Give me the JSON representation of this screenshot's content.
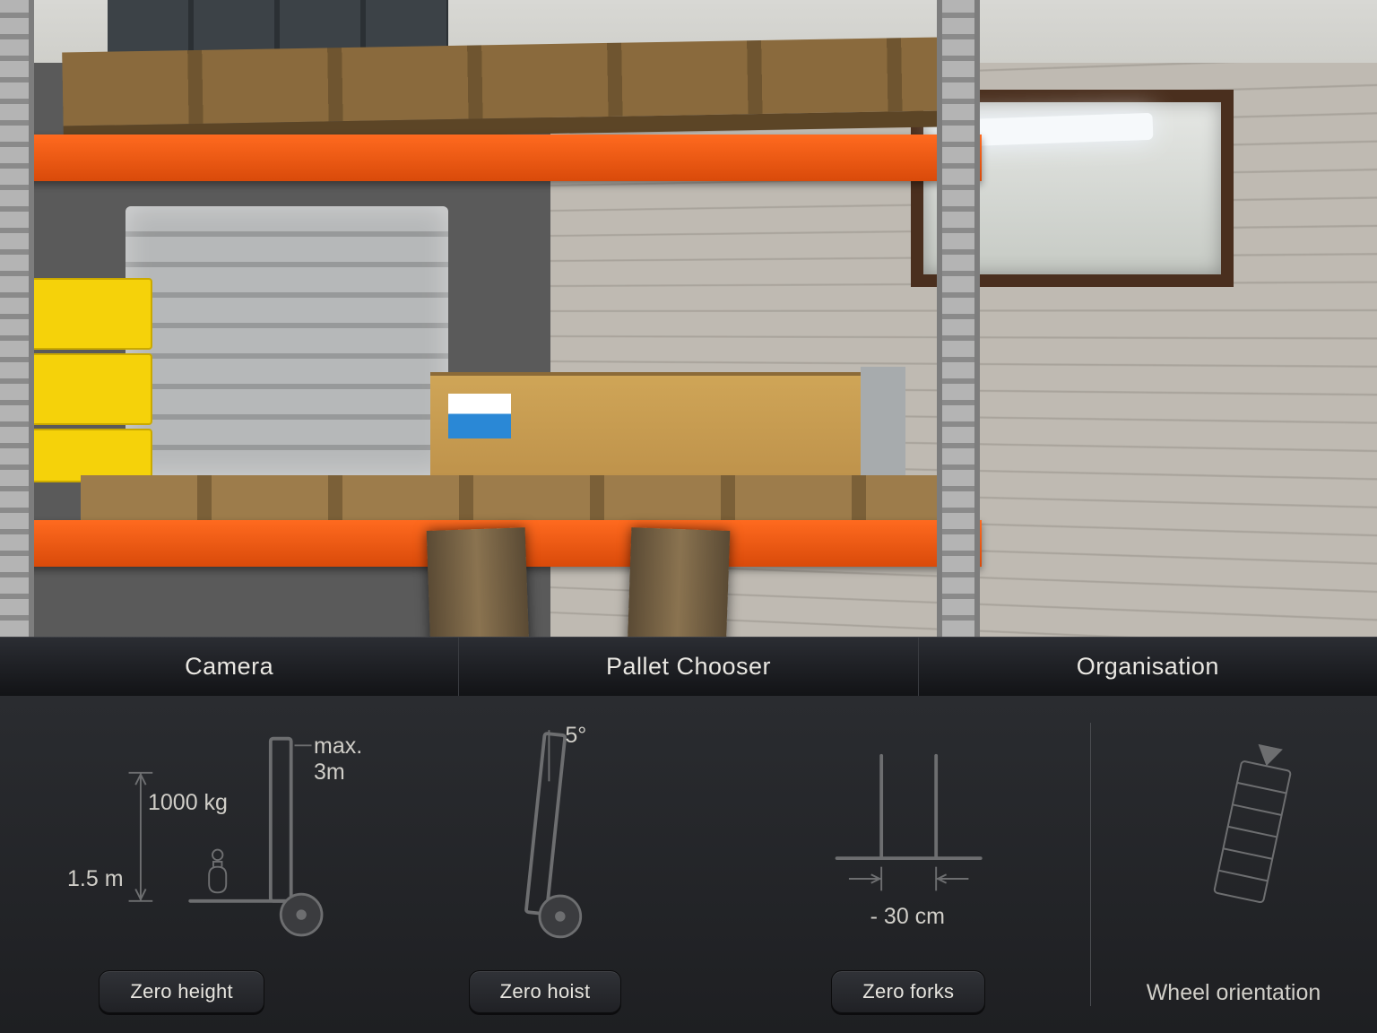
{
  "tabs": {
    "camera": "Camera",
    "pallet_chooser": "Pallet Chooser",
    "organisation": "Organisation"
  },
  "height_widget": {
    "current_height": "1.5 m",
    "load": "1000 kg",
    "max_height": "max. 3m",
    "button": "Zero height"
  },
  "hoist_widget": {
    "tilt_angle": "5°",
    "button": "Zero hoist"
  },
  "forks_widget": {
    "spread": "- 30 cm",
    "button": "Zero forks"
  },
  "wheel_widget": {
    "label": "Wheel orientation"
  }
}
